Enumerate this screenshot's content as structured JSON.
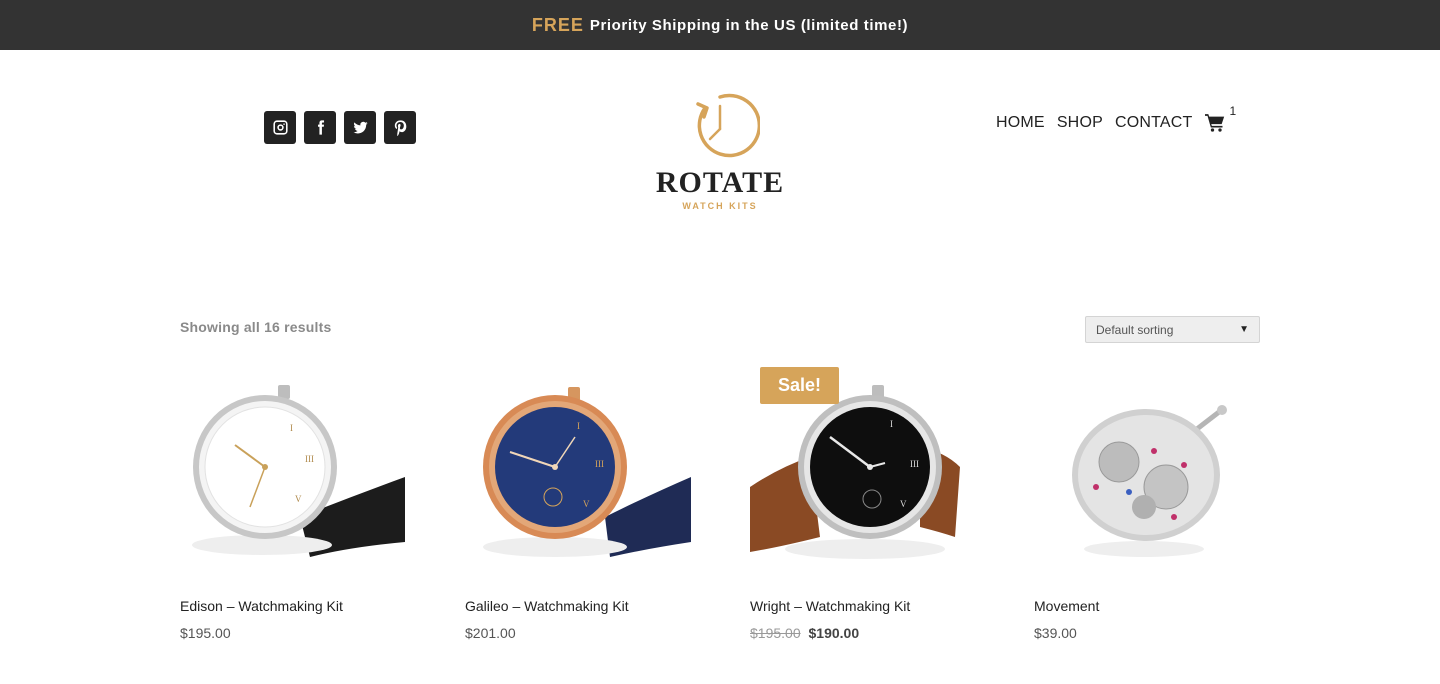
{
  "announcement": {
    "highlight": "FREE",
    "message": "Priority Shipping in the US (limited time!)",
    "accent_color": "#d6a45a",
    "background": "#333333"
  },
  "social": [
    {
      "name": "instagram-icon"
    },
    {
      "name": "facebook-icon"
    },
    {
      "name": "twitter-icon"
    },
    {
      "name": "pinterest-icon"
    }
  ],
  "logo": {
    "brand": "ROTATE",
    "tagline": "WATCH KITS"
  },
  "nav": {
    "items": [
      "HOME",
      "SHOP",
      "CONTACT"
    ],
    "cart_icon": "cart-icon",
    "cart_count": "1"
  },
  "shop": {
    "results_text": "Showing all 16 results",
    "sort_selected": "Default sorting"
  },
  "products": [
    {
      "name": "Edison – Watchmaking Kit",
      "price": "$195.00",
      "dial": "white"
    },
    {
      "name": "Galileo – Watchmaking Kit",
      "price": "$201.00",
      "dial": "blue"
    },
    {
      "name": "Wright – Watchmaking Kit",
      "old_price": "$195.00",
      "price": "$190.00",
      "badge": "Sale!",
      "dial": "black"
    },
    {
      "name": "Movement",
      "price": "$39.00",
      "dial": "movement"
    }
  ]
}
